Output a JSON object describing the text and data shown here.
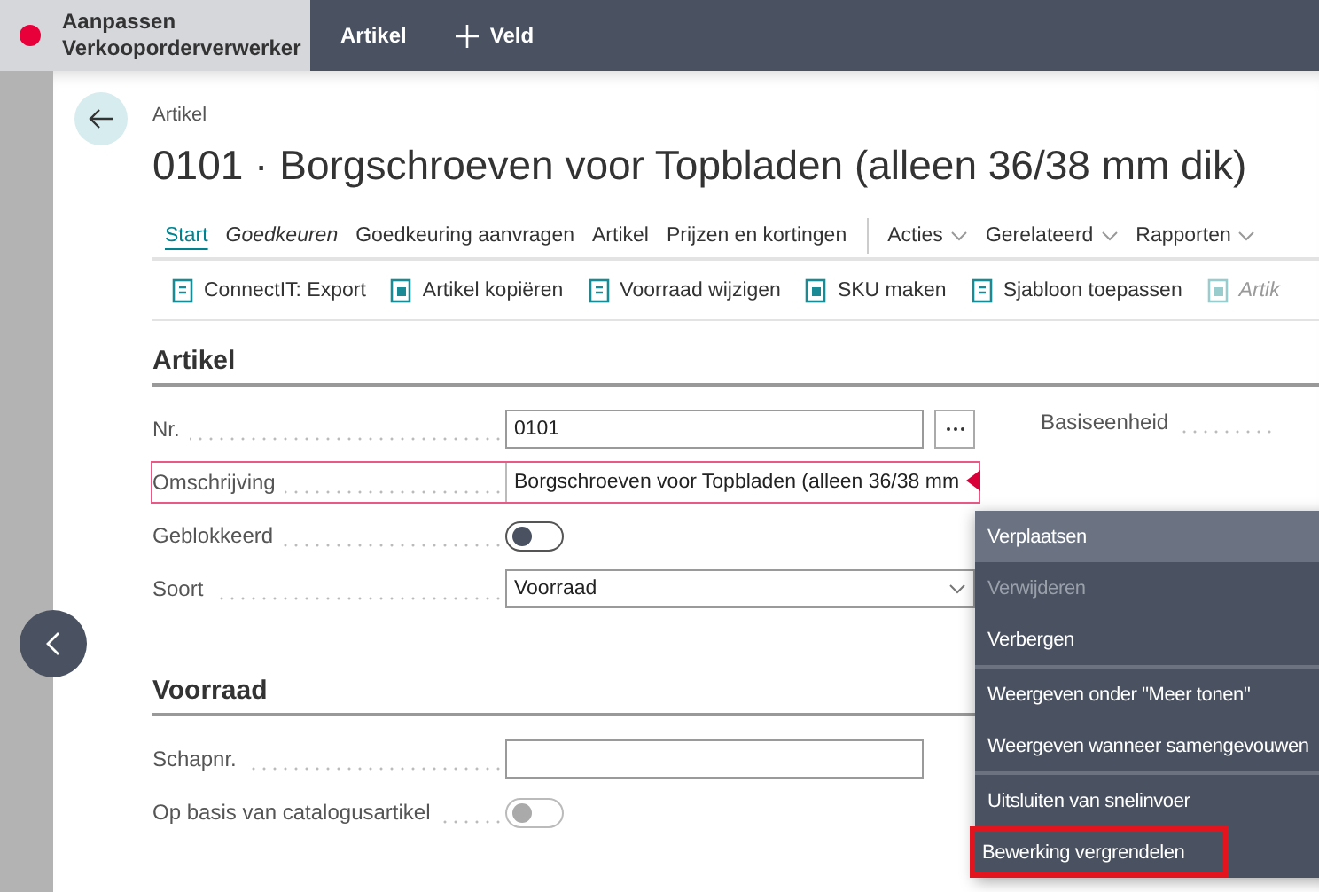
{
  "topbar": {
    "title": "Aanpassen Verkooporderverwerker",
    "actions": [
      {
        "label": "Artikel",
        "kind": "text"
      },
      {
        "label": "Veld",
        "kind": "add"
      }
    ]
  },
  "page": {
    "breadcrumb": "Artikel",
    "title": "0101 · Borgschroeven voor Topbladen (alleen 36/38 mm dik)"
  },
  "action_tabs": [
    {
      "label": "Start",
      "selected": true,
      "italic": false,
      "kind": "tab"
    },
    {
      "label": "Goedkeuren",
      "selected": false,
      "italic": true,
      "kind": "tab"
    },
    {
      "label": "Goedkeuring aanvragen",
      "selected": false,
      "italic": false,
      "kind": "tab"
    },
    {
      "label": "Artikel",
      "selected": false,
      "italic": false,
      "kind": "tab"
    },
    {
      "label": "Prijzen en kortingen",
      "selected": false,
      "italic": false,
      "kind": "tab"
    },
    {
      "label": "Acties",
      "selected": false,
      "italic": false,
      "kind": "menu"
    },
    {
      "label": "Gerelateerd",
      "selected": false,
      "italic": false,
      "kind": "menu"
    },
    {
      "label": "Rapporten",
      "selected": false,
      "italic": false,
      "kind": "menu"
    }
  ],
  "toolbar": [
    {
      "label": "ConnectIT: Export",
      "disabled": false
    },
    {
      "label": "Artikel kopiëren",
      "disabled": false
    },
    {
      "label": "Voorraad wijzigen",
      "disabled": false
    },
    {
      "label": "SKU maken",
      "disabled": false
    },
    {
      "label": "Sjabloon toepassen",
      "disabled": false
    },
    {
      "label": "Artik",
      "disabled": true
    }
  ],
  "sections": [
    {
      "title": "Artikel",
      "fields": [
        {
          "label": "Nr.",
          "kind": "lookup",
          "value": "0101",
          "highlighted": false
        },
        {
          "label": "Omschrijving",
          "kind": "text",
          "value": "Borgschroeven voor Topbladen (alleen 36/38 mm",
          "highlighted": true
        },
        {
          "label": "Geblokkeerd",
          "kind": "toggle",
          "on": false,
          "disabled": false,
          "highlighted": false
        },
        {
          "label": "Soort",
          "kind": "select",
          "value": "Voorraad",
          "highlighted": false
        }
      ],
      "right_fields": [
        {
          "label": "Basiseenheid"
        }
      ]
    },
    {
      "title": "Voorraad",
      "fields": [
        {
          "label": "Schapnr.",
          "kind": "text",
          "highlighted": false
        },
        {
          "label": "Op basis van catalogusartikel",
          "kind": "toggle",
          "on": false,
          "disabled": true,
          "highlighted": false
        }
      ]
    }
  ],
  "context_menu": {
    "groups": [
      [
        {
          "label": "Verplaatsen",
          "selected": true,
          "disabled": false,
          "outlined": false
        },
        {
          "label": "Verwijderen",
          "selected": false,
          "disabled": true,
          "outlined": false
        },
        {
          "label": "Verbergen",
          "selected": false,
          "disabled": false,
          "outlined": false
        }
      ],
      [
        {
          "label": "Weergeven onder \"Meer tonen\"",
          "selected": false,
          "disabled": false,
          "outlined": false
        },
        {
          "label": "Weergeven wanneer samengevouwen",
          "selected": false,
          "disabled": false,
          "outlined": false
        }
      ],
      [
        {
          "label": "Uitsluiten van snelinvoer",
          "selected": false,
          "disabled": false,
          "outlined": false
        },
        {
          "label": "Bewerking vergrendelen",
          "selected": false,
          "disabled": false,
          "outlined": true
        }
      ]
    ]
  }
}
